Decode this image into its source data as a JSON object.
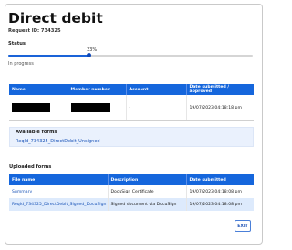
{
  "page": {
    "title": "Direct debit",
    "request_id": "Request ID: 734325"
  },
  "status": {
    "label": "Status",
    "progress_percent": 33,
    "progress_text": "33%",
    "state": "In progress"
  },
  "details_table": {
    "headers": [
      "Name",
      "Member number",
      "Account",
      "Date submitted / approved"
    ],
    "row": {
      "name": "",
      "member_number": "",
      "account": "-",
      "date": "19/07/2023 04:18:18 pm"
    }
  },
  "available_forms": {
    "heading": "Available forms",
    "link": "ReqId_734325_DirectDebit_Unsigned"
  },
  "uploaded_forms": {
    "heading": "Uploaded forms",
    "headers": [
      "File name",
      "Description",
      "Date submitted"
    ],
    "rows": [
      {
        "file": "Summary",
        "description": "DocuSign Certificate",
        "date": "19/07/2023 04:18:08 pm"
      },
      {
        "file": "ReqId_734325_DirectDebit_Signed_DocuSign",
        "description": "Signed document via DocuSign",
        "date": "19/07/2023 04:18:08 pm"
      }
    ]
  },
  "actions": {
    "exit_label": "EXIT"
  },
  "colors": {
    "accent": "#1566dc",
    "link": "#1a54b8",
    "highlight_row": "#ddeafc",
    "panel": "#eaf1fd"
  }
}
